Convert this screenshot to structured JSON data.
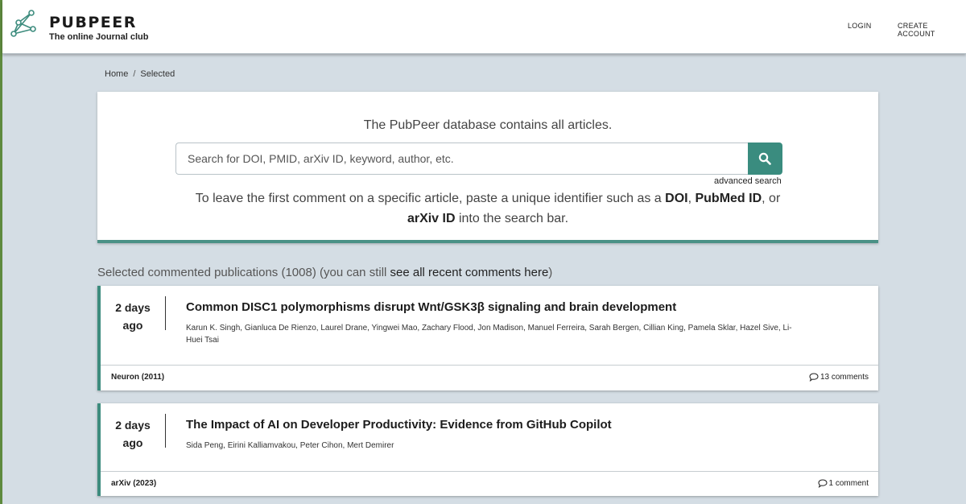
{
  "header": {
    "brand_name": "PUBPEER",
    "tagline": "The online Journal club",
    "nav": {
      "login": "LOGIN",
      "create_account": "CREATE ACCOUNT"
    }
  },
  "breadcrumb": {
    "home": "Home",
    "separator": "/",
    "current": "Selected"
  },
  "search": {
    "db_text": "The PubPeer database contains all articles.",
    "placeholder": "Search for DOI, PMID, arXiv ID, keyword, author, etc.",
    "advanced": "advanced search",
    "instructions": {
      "part1": "To leave the first comment on a specific article, paste a unique identifier such as a ",
      "doi": "DOI",
      "comma": ", ",
      "pubmed": "PubMed ID",
      "or": ", or ",
      "arxiv": "arXiv ID",
      "part2": " into the search bar."
    }
  },
  "selected": {
    "prefix": "Selected commented publications (1008) (you can still ",
    "link": "see all recent comments here",
    "suffix": ")"
  },
  "publications": [
    {
      "time_line1": "2 days",
      "time_line2": "ago",
      "title": "Common DISC1 polymorphisms disrupt Wnt/GSK3β signaling and brain development",
      "authors": "Karun K. Singh, Gianluca De Rienzo, Laurel Drane, Yingwei Mao, Zachary Flood, Jon Madison, Manuel Ferreira, Sarah Bergen, Cillian King, Pamela Sklar, Hazel Sive, Li-Huei Tsai",
      "journal": "Neuron (2011)",
      "comments": "13 comments"
    },
    {
      "time_line1": "2 days",
      "time_line2": "ago",
      "title": "The Impact of AI on Developer Productivity: Evidence from GitHub Copilot",
      "authors": "Sida Peng, Eirini Kalliamvakou, Peter Cihon, Mert Demirer",
      "journal": "arXiv (2023)",
      "comments": "1 comment"
    }
  ],
  "colors": {
    "accent": "#3a8c7f",
    "background": "#d4dde4",
    "left_edge": "#5e8a3e"
  },
  "icons": {
    "logo": "pubpeer-network-logo-icon",
    "search": "magnifier-icon",
    "comment": "speech-bubble-icon"
  }
}
